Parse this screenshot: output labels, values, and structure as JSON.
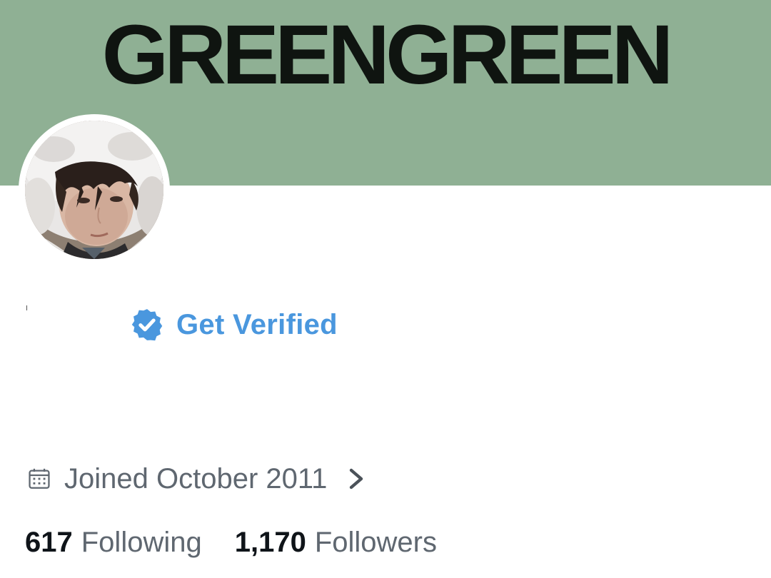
{
  "banner": {
    "title": "GREENGREEN",
    "background_color": "#8fb094"
  },
  "profile": {
    "avatar_icon": "profile-photo"
  },
  "verify": {
    "label": "Get Verified",
    "badge_icon": "verified-badge-icon",
    "color": "#4a97de"
  },
  "joined": {
    "icon": "calendar-icon",
    "text": "Joined October 2011",
    "chevron_icon": "chevron-right-icon"
  },
  "stats": {
    "following_count": "617",
    "following_label": "Following",
    "followers_count": "1,170",
    "followers_label": "Followers"
  }
}
